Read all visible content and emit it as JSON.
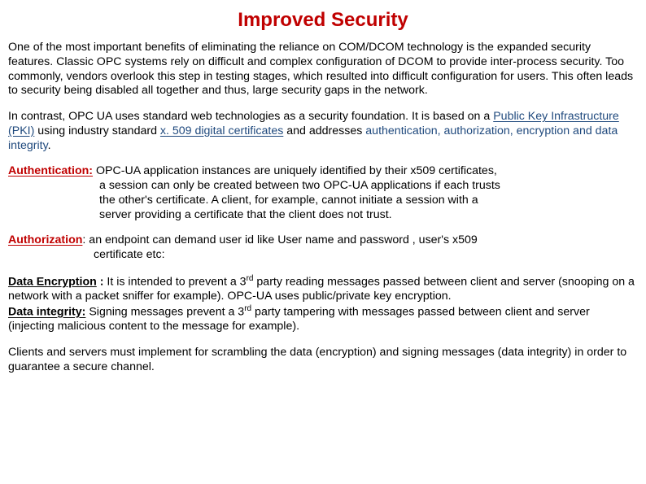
{
  "title": "Improved Security",
  "p1": "One of the most important benefits of eliminating the reliance on COM/DCOM technology is the expanded security features. Classic OPC systems rely on difficult and complex configuration of DCOM to provide inter-process security. Too commonly, vendors overlook this step in testing stages, which resulted into difficult configuration for users. This often leads to security being disabled all together and thus, large security gaps in the network.",
  "p2a": "In contrast, OPC UA uses standard web technologies as a security foundation. It is based on a ",
  "p2b": "Public Key Infrastructure (PKI)",
  "p2c": " using industry standard ",
  "p2d": "x. 509 digital certificates",
  "p2e": " and addresses ",
  "p2f": "authentication, authorization, encryption and data integrity",
  "p2g": ".",
  "auth_label": "Authentication:",
  "auth_l1": " OPC-UA application instances are uniquely identified by their x509 certificates,",
  "auth_l2": "a session can only be created between two OPC-UA applications if each trusts",
  "auth_l3": "the other's certificate. A client, for example, cannot initiate a session with a",
  "auth_l4": "server providing a certificate that the client does not trust.",
  "authz_label": "Authorization",
  "authz_l1": ":  an endpoint can demand user id like User name and password , user's x509",
  "authz_l2": "certificate  etc:",
  "enc_label": "Data Encryption",
  "enc_colon": " : ",
  "enc_a": "It is intended to prevent a 3",
  "enc_rd": "rd",
  "enc_b": " party reading messages passed between client and server (snooping on a network with a packet sniffer for example).  OPC-UA uses public/private key encryption.",
  "di_label": "Data integrity:",
  "di_a": " Signing messages prevent a 3",
  "di_rd": "rd",
  "di_b": " party tampering with messages passed between client and server (injecting malicious content to the message for example).",
  "p_last": "Clients and servers must implement for scrambling the data (encryption) and signing messages (data integrity) in order to guarantee a secure channel."
}
